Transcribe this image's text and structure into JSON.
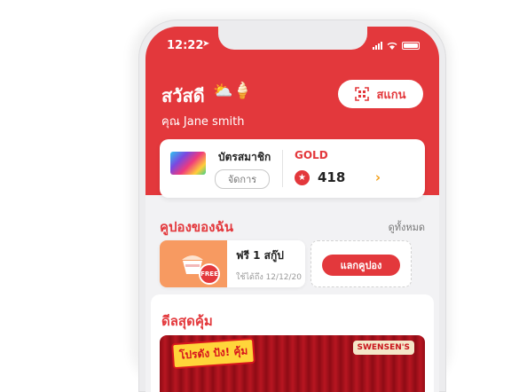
{
  "status_bar": {
    "time": "12:22"
  },
  "header": {
    "greeting": "สวัสดี",
    "greeting_emoji": "⛅🍦",
    "user_name": "คุณ Jane smith",
    "scan_label": "สแกน"
  },
  "membership": {
    "card_label": "บัตรสมาชิก",
    "manage_label": "จัดการ",
    "tier": "GOLD",
    "points": "418"
  },
  "coupons": {
    "section_title": "คูปองของฉัน",
    "see_all": "ดูทั้งหมด",
    "items": [
      {
        "title": "ฟรี 1 สกู๊ป",
        "badge": "FREE",
        "expiry": "ใช้ได้ถึง 12/12/20"
      }
    ],
    "redeem_label": "แลกคูปอง"
  },
  "deals": {
    "section_title": "ดีลสุดคุ้ม",
    "banner_text": "โปรดัง ปัง! คุ้ม",
    "brand": "SWENSEN'S"
  },
  "colors": {
    "brand_red": "#e3383c",
    "accent_orange": "#f79a61",
    "chevron_yellow": "#f2a01b"
  }
}
